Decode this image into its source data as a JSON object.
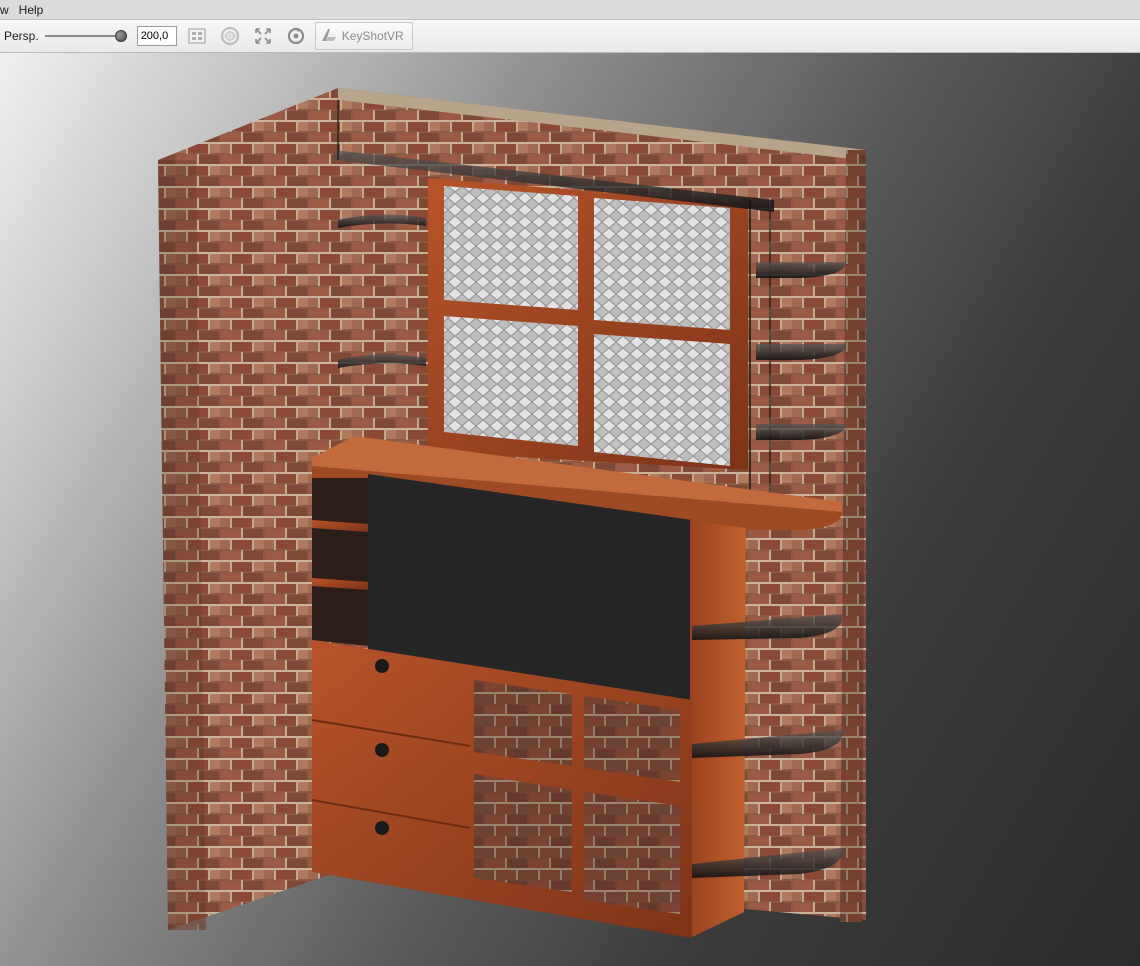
{
  "menu": {
    "items": [
      "w",
      "Help"
    ]
  },
  "toolbar": {
    "persp_label": "Persp.",
    "perspective_value": "200,0",
    "perspective_level": 0.98,
    "vr_label": "KeyShotVR",
    "icons": [
      "grid-icon",
      "target-icon",
      "expand-icon",
      "refresh-icon",
      "keyshotvr-icon"
    ]
  },
  "viewport": {
    "scene": "render-of-brick-wall-cabinet-with-window"
  },
  "colors": {
    "toolbar_bg": "#efefef",
    "brick": "#8a5a45",
    "wood": "#a84a24",
    "dark_panel": "#252525",
    "glass": "#c9c9c9"
  }
}
